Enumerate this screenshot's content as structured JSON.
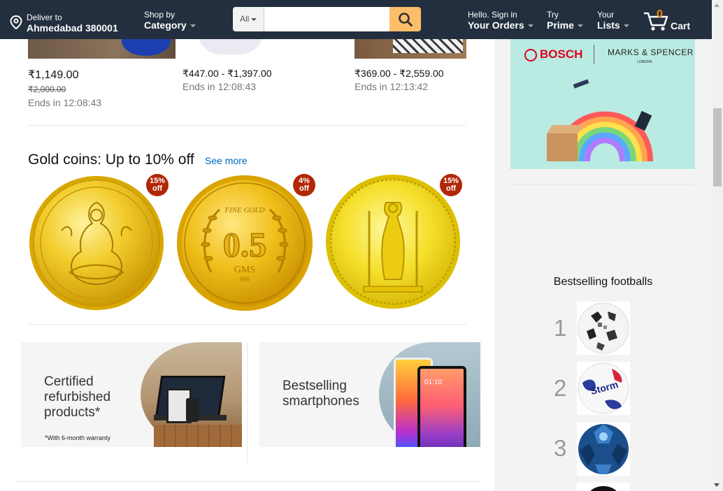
{
  "header": {
    "deliver_small": "Deliver to",
    "deliver_big": "Ahmedabad 380001",
    "shop_small": "Shop by",
    "shop_big": "Category",
    "search_category": "All",
    "search_placeholder": "",
    "hello_small": "Hello. Sign in",
    "orders_big": "Your Orders",
    "try_small": "Try",
    "prime_big": "Prime",
    "your_small": "Your",
    "lists_big": "Lists",
    "cart_count": "0",
    "cart_label": "Cart",
    "icons": [
      "location-pin-icon",
      "search-icon",
      "cart-icon"
    ]
  },
  "deals": [
    {
      "price": "₹1,149.00",
      "old_price": "₹2,000.00",
      "ends": "Ends in 12:08:43"
    },
    {
      "price": "₹447.00 - ₹1,397.00",
      "ends": "Ends in 12:08:43"
    },
    {
      "price": "₹369.00 - ₹2,559.00",
      "ends": "Ends in 12:13:42"
    }
  ],
  "gold": {
    "title": "Gold coins: Up to 10% off",
    "see_more": "See more",
    "coins": [
      {
        "badge_pct": "15%",
        "badge_off": "off"
      },
      {
        "badge_pct": "4%",
        "badge_off": "off",
        "text_top": "FINE GOLD",
        "value": "0.5",
        "unit": "GMS",
        "purity": "999"
      },
      {
        "badge_pct": "15%",
        "badge_off": "off"
      }
    ]
  },
  "promos": [
    {
      "line1": "Certified",
      "line2": "refurbished",
      "line3": "products*",
      "note": "*With 6-month warranty"
    },
    {
      "line1": "Bestselling",
      "line2": "smartphones",
      "phone_time": "01:10"
    }
  ],
  "sidebar": {
    "ad_brand1": "BOSCH",
    "ad_brand2": "MARKS & SPENCER",
    "ad_brand2_sub": "LONDON",
    "best_title": "Bestselling footballs",
    "ranks": [
      "1",
      "2",
      "3"
    ],
    "ball2_text": "Storm"
  },
  "colors": {
    "header_bg": "#232f3e",
    "search_button": "#febd69",
    "cart_count": "#f08804",
    "link": "#0066c0",
    "badge": "#b12704"
  }
}
